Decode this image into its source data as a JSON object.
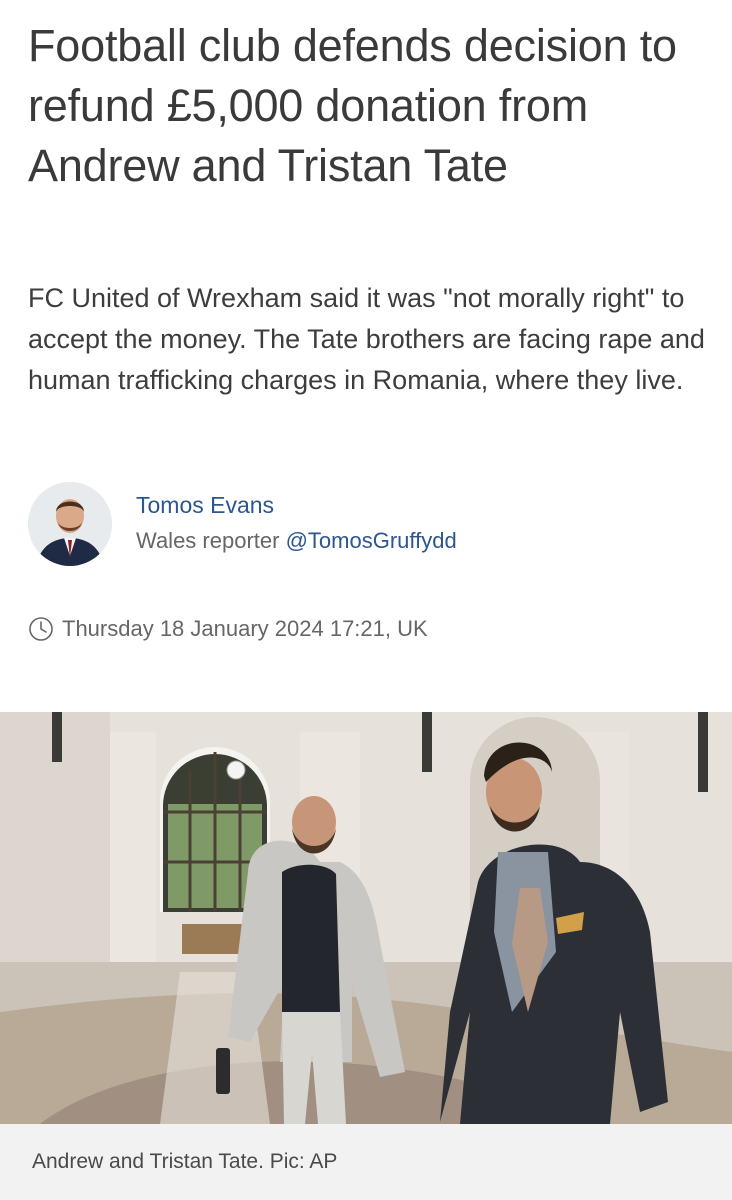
{
  "article": {
    "headline": "Football club defends decision to refund £5,000 donation from Andrew and Tristan Tate",
    "standfirst": "FC United of Wrexham said it was \"not morally right\" to accept the money. The Tate brothers are facing rape and human trafficking charges in Romania, where they live."
  },
  "author": {
    "name": "Tomos Evans",
    "role": "Wales reporter",
    "handle": "@TomosGruffydd"
  },
  "published": {
    "datetime": "Thursday 18 January 2024 17:21, UK"
  },
  "image": {
    "caption": "Andrew and Tristan Tate. Pic: AP"
  },
  "icons": {
    "clock": "clock-icon"
  },
  "colors": {
    "link": "#2d5592",
    "headline": "#3a3a3a",
    "meta": "#666666",
    "caption_bg": "#f2f2f2"
  }
}
